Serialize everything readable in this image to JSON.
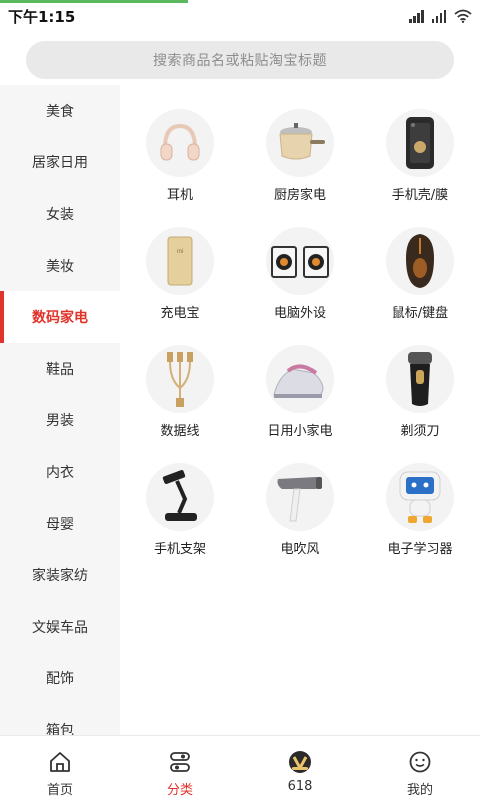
{
  "status_bar": {
    "time": "下午1:15"
  },
  "search": {
    "placeholder": "搜索商品名或粘贴淘宝标题"
  },
  "sidebar": {
    "items": [
      {
        "label": "美食"
      },
      {
        "label": "居家日用"
      },
      {
        "label": "女装"
      },
      {
        "label": "美妆"
      },
      {
        "label": "数码家电",
        "active": true
      },
      {
        "label": "鞋品"
      },
      {
        "label": "男装"
      },
      {
        "label": "内衣"
      },
      {
        "label": "母婴"
      },
      {
        "label": "家装家纺"
      },
      {
        "label": "文娱车品"
      },
      {
        "label": "配饰"
      },
      {
        "label": "箱包"
      }
    ]
  },
  "categories": [
    {
      "label": "耳机",
      "icon": "headphones-icon"
    },
    {
      "label": "厨房家电",
      "icon": "cooking-pot-icon"
    },
    {
      "label": "手机壳/膜",
      "icon": "phone-case-icon"
    },
    {
      "label": "充电宝",
      "icon": "power-bank-icon"
    },
    {
      "label": "电脑外设",
      "icon": "speakers-icon"
    },
    {
      "label": "鼠标/键盘",
      "icon": "gaming-mouse-icon"
    },
    {
      "label": "数据线",
      "icon": "usb-cable-icon"
    },
    {
      "label": "日用小家电",
      "icon": "steam-iron-icon"
    },
    {
      "label": "剃须刀",
      "icon": "shaver-icon"
    },
    {
      "label": "手机支架",
      "icon": "phone-stand-icon"
    },
    {
      "label": "电吹风",
      "icon": "hair-dryer-icon"
    },
    {
      "label": "电子学习器",
      "icon": "learning-robot-icon"
    }
  ],
  "bottom_nav": {
    "items": [
      {
        "label": "首页",
        "icon": "home-icon"
      },
      {
        "label": "分类",
        "icon": "category-icon",
        "active": true
      },
      {
        "label": "618",
        "icon": "v-badge-icon"
      },
      {
        "label": "我的",
        "icon": "smile-face-icon"
      }
    ]
  },
  "colors": {
    "accent": "#e0332a",
    "progress": "#5cb85c",
    "sidebar_bg": "#f6f6f6",
    "search_bg": "#e9e9e9"
  }
}
